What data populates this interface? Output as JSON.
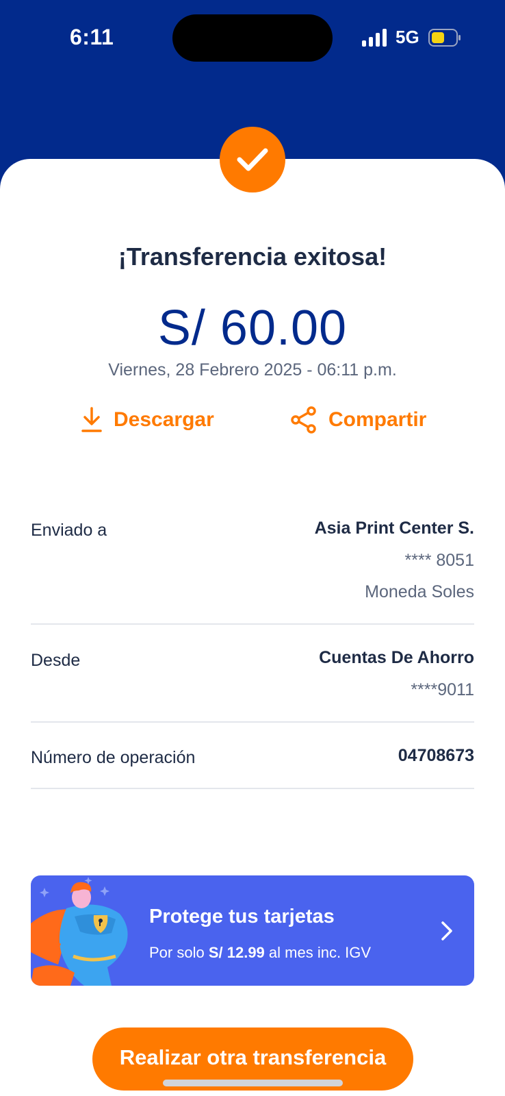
{
  "status_bar": {
    "time": "6:11",
    "network": "5G",
    "battery_color": "#f5d312"
  },
  "colors": {
    "header_blue": "#022a8c",
    "accent_orange": "#ff7a00",
    "promo_blue": "#4a63ee"
  },
  "receipt": {
    "title": "¡Transferencia exitosa!",
    "amount": "S/ 60.00",
    "datetime": "Viernes, 28 Febrero 2025 - 06:11 p.m.",
    "actions": {
      "download": {
        "label": "Descargar",
        "icon": "download-icon"
      },
      "share": {
        "label": "Compartir",
        "icon": "share-icon"
      }
    }
  },
  "details": {
    "sent_to": {
      "label": "Enviado a",
      "name": "Asia Print Center S.",
      "account": "**** 8051",
      "currency": "Moneda Soles"
    },
    "from": {
      "label": "Desde",
      "account_type": "Cuentas De Ahorro",
      "account": "****9011"
    },
    "operation": {
      "label": "Número de operación",
      "number": "04708673"
    }
  },
  "promo": {
    "title": "Protege tus tarjetas",
    "subtitle_prefix": "Por solo",
    "price": "S/ 12.99",
    "subtitle_suffix": "al mes inc. IGV"
  },
  "cta": {
    "label": "Realizar otra transferencia"
  }
}
